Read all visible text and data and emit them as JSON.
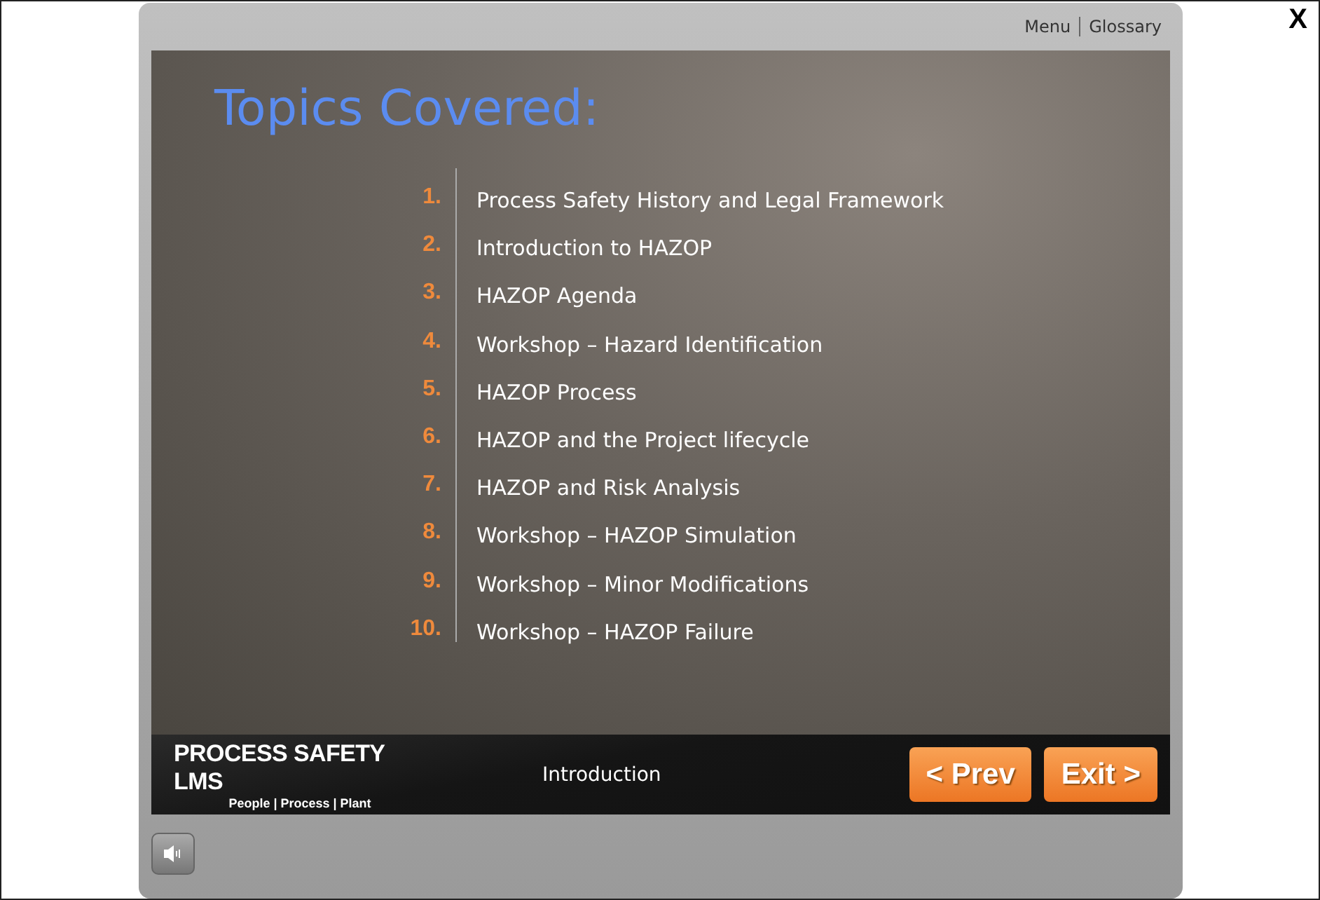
{
  "close_button": "X",
  "top_links": [
    "Menu",
    "Glossary"
  ],
  "slide": {
    "title": "Topics Covered:",
    "topics": [
      {
        "number": "1.",
        "label": "Process Safety History and Legal Framework"
      },
      {
        "number": "2.",
        "label": "Introduction to HAZOP"
      },
      {
        "number": "3.",
        "label": "HAZOP Agenda"
      },
      {
        "number": "4.",
        "label": "Workshop – Hazard Identification"
      },
      {
        "number": "5.",
        "label": "HAZOP Process"
      },
      {
        "number": "6.",
        "label": "HAZOP and the Project lifecycle"
      },
      {
        "number": "7.",
        "label": "HAZOP and Risk Analysis"
      },
      {
        "number": "8.",
        "label": "Workshop – HAZOP Simulation"
      },
      {
        "number": "9.",
        "label": "Workshop – Minor Modifications"
      },
      {
        "number": "10.",
        "label": "Workshop – HAZOP Failure"
      }
    ]
  },
  "footer": {
    "logo_title": "PROCESS SAFETY LMS",
    "logo_tagline": "People | Process | Plant",
    "section": "Introduction",
    "buttons": [
      "< Prev",
      "Exit >"
    ]
  }
}
